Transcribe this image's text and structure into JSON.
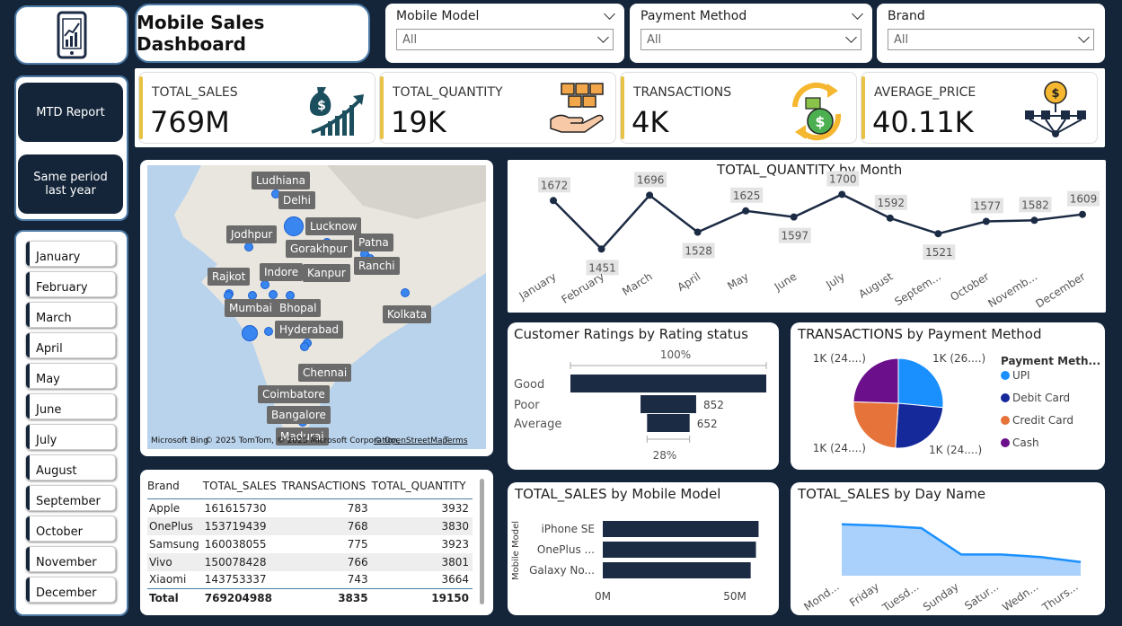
{
  "header": {
    "title": "Mobile Sales Dashboard",
    "logo_icon": "phone-chart-icon"
  },
  "filters": [
    {
      "label": "Mobile Model",
      "value": "All"
    },
    {
      "label": "Payment Method",
      "value": "All"
    },
    {
      "label": "Brand",
      "value": "All"
    }
  ],
  "nav": {
    "mtd": "MTD Report",
    "same_period": "Same period last year"
  },
  "months": [
    "January",
    "February",
    "March",
    "April",
    "May",
    "June",
    "July",
    "August",
    "September",
    "October",
    "November",
    "December"
  ],
  "kpis": [
    {
      "label": "TOTAL_SALES",
      "value": "769M",
      "icon": "money-bag-growth-icon"
    },
    {
      "label": "TOTAL_QUANTITY",
      "value": "19K",
      "icon": "boxes-hand-icon"
    },
    {
      "label": "TRANSACTIONS",
      "value": "4K",
      "icon": "money-exchange-icon"
    },
    {
      "label": "AVERAGE_PRICE",
      "value": "40.11K",
      "icon": "coin-network-icon"
    }
  ],
  "map": {
    "cities": [
      "Ludhiana",
      "Delhi",
      "Jodhpur",
      "Lucknow",
      "Gorakhpur",
      "Patna",
      "Rajkot",
      "Indore",
      "Kanpur",
      "Ranchi",
      "Mumbai",
      "Bhopal",
      "Kolkata",
      "Hyderabad",
      "Chennai",
      "Coimbatore",
      "Bangalore",
      "Madurai"
    ],
    "attribution": "© 2025 TomTom, © 2025 Microsoft Corporation,",
    "osm": "© OpenStreetMap",
    "terms": "Terms",
    "brand": "Microsoft Bing"
  },
  "table": {
    "columns": [
      "Brand",
      "TOTAL_SALES",
      "TRANSACTIONS",
      "TOTAL_QUANTITY"
    ],
    "rows": [
      [
        "Apple",
        "161615730",
        "783",
        "3932"
      ],
      [
        "OnePlus",
        "153719439",
        "768",
        "3830"
      ],
      [
        "Samsung",
        "160038055",
        "775",
        "3923"
      ],
      [
        "Vivo",
        "150078428",
        "766",
        "3801"
      ],
      [
        "Xiaomi",
        "143753337",
        "743",
        "3664"
      ]
    ],
    "total": [
      "Total",
      "769204988",
      "3835",
      "19150"
    ]
  },
  "chart_data": [
    {
      "type": "line",
      "title": "TOTAL_QUANTITY by Month",
      "categories": [
        "January",
        "February",
        "March",
        "April",
        "May",
        "June",
        "July",
        "August",
        "September",
        "October",
        "November",
        "December"
      ],
      "tick_labels": [
        "January",
        "February",
        "March",
        "April",
        "May",
        "June",
        "July",
        "August",
        "Septem...",
        "October",
        "Novemb...",
        "December"
      ],
      "values": [
        1672,
        1451,
        1696,
        1528,
        1625,
        1597,
        1700,
        1592,
        1521,
        1577,
        1582,
        1609
      ],
      "color": "#1c2b44"
    },
    {
      "type": "bar",
      "title": "Customer Ratings by Rating status",
      "categories": [
        "Good",
        "Poor",
        "Average"
      ],
      "values": [
        3000,
        852,
        652
      ],
      "data_labels": [
        "",
        "852",
        "652"
      ],
      "top_label": "100%",
      "bottom_label": "28%",
      "color": "#1c2b44"
    },
    {
      "type": "pie",
      "title": "TRANSACTIONS by Payment Method",
      "legend_title": "Payment Meth...",
      "series": [
        {
          "name": "UPI",
          "value": 26,
          "label": "1K (26....)",
          "color": "#1a90ff"
        },
        {
          "name": "Debit Card",
          "value": 24,
          "label": "1K (24....)",
          "color": "#15299a"
        },
        {
          "name": "Credit Card",
          "value": 24,
          "label": "1K (24....)",
          "color": "#e5733a"
        },
        {
          "name": "Cash",
          "value": 24,
          "label": "1K (24....)",
          "color": "#6b0f8a"
        }
      ]
    },
    {
      "type": "bar",
      "title": "TOTAL_SALES by Mobile Model",
      "ylabel": "Mobile Model",
      "categories": [
        "iPhone SE",
        "OnePlus ...",
        "Galaxy No..."
      ],
      "values": [
        59,
        58,
        56
      ],
      "x_ticks": [
        "0M",
        "50M"
      ],
      "xlim": [
        0,
        60
      ],
      "color": "#1c2b44"
    },
    {
      "type": "area",
      "title": "TOTAL_SALES by Day Name",
      "categories": [
        "Mond...",
        "Friday",
        "Tuesd...",
        "Sunday",
        "Satur...",
        "Wedn...",
        "Thurs..."
      ],
      "values": [
        118,
        117,
        115,
        94,
        94,
        92,
        88
      ],
      "ylim": [
        80,
        120
      ],
      "color": "#1a90ff"
    }
  ]
}
